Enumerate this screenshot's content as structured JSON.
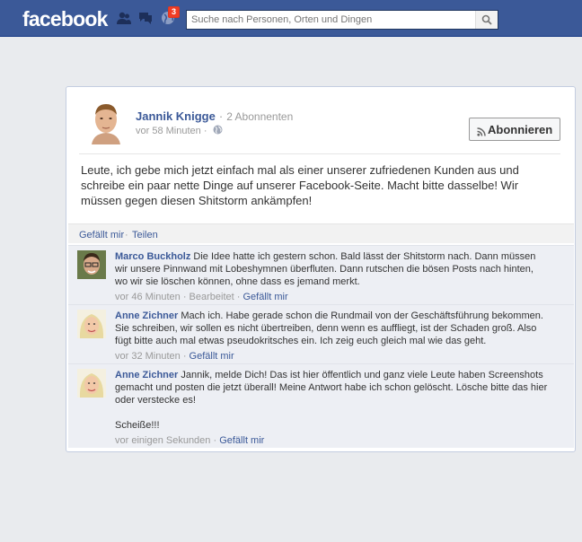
{
  "header": {
    "logo": "facebook",
    "notification_count": "3",
    "search_placeholder": "Suche nach Personen, Orten und Dingen"
  },
  "post": {
    "author": "Jannik Knigge",
    "subscribers": "2 Abonnenten",
    "time": "vor 58 Minuten",
    "subscribe_label": "Abonnieren",
    "text": "Leute, ich gebe mich jetzt einfach mal als einer unserer zufriedenen Kunden aus und schreibe ein paar nette Dinge auf unserer Facebook-Seite. Macht bitte dasselbe! Wir müssen gegen diesen Shitstorm ankämpfen!",
    "like_label": "Gefällt mir",
    "share_label": "Teilen"
  },
  "comments": [
    {
      "author": "Marco Buckholz",
      "text": "Die Idee hatte ich gestern schon. Bald lässt der Shitstorm nach. Dann müssen wir unsere Pinnwand mit Lobeshymnen überfluten. Dann rutschen die bösen Posts nach hinten, wo wir sie löschen können, ohne dass es jemand merkt.",
      "time": "vor 46 Minuten",
      "edited": "Bearbeitet",
      "like_label": "Gefällt mir"
    },
    {
      "author": "Anne Zichner",
      "text": "Mach ich. Habe gerade schon die Rundmail von der Geschäftsführung bekommen. Sie schreiben, wir sollen es nicht übertreiben, denn wenn es auffliegt, ist der Schaden groß. Also fügt bitte auch mal etwas pseudokritsches ein. Ich zeig euch gleich mal wie das geht.",
      "time": "vor 32 Minuten",
      "like_label": "Gefällt mir"
    },
    {
      "author": "Anne Zichner",
      "text": "Jannik, melde Dich! Das ist hier öffentlich und ganz viele Leute haben Screenshots gemacht und posten die jetzt überall! Meine Antwort habe ich schon gelöscht. Lösche bitte das hier oder verstecke es!",
      "text2": "Scheiße!!!",
      "time": "vor einigen Sekunden",
      "like_label": "Gefällt mir"
    }
  ],
  "colors": {
    "brand": "#3b5998",
    "background": "#e9ebee",
    "comment_bg": "#edeff4",
    "badge": "#f03d25"
  }
}
